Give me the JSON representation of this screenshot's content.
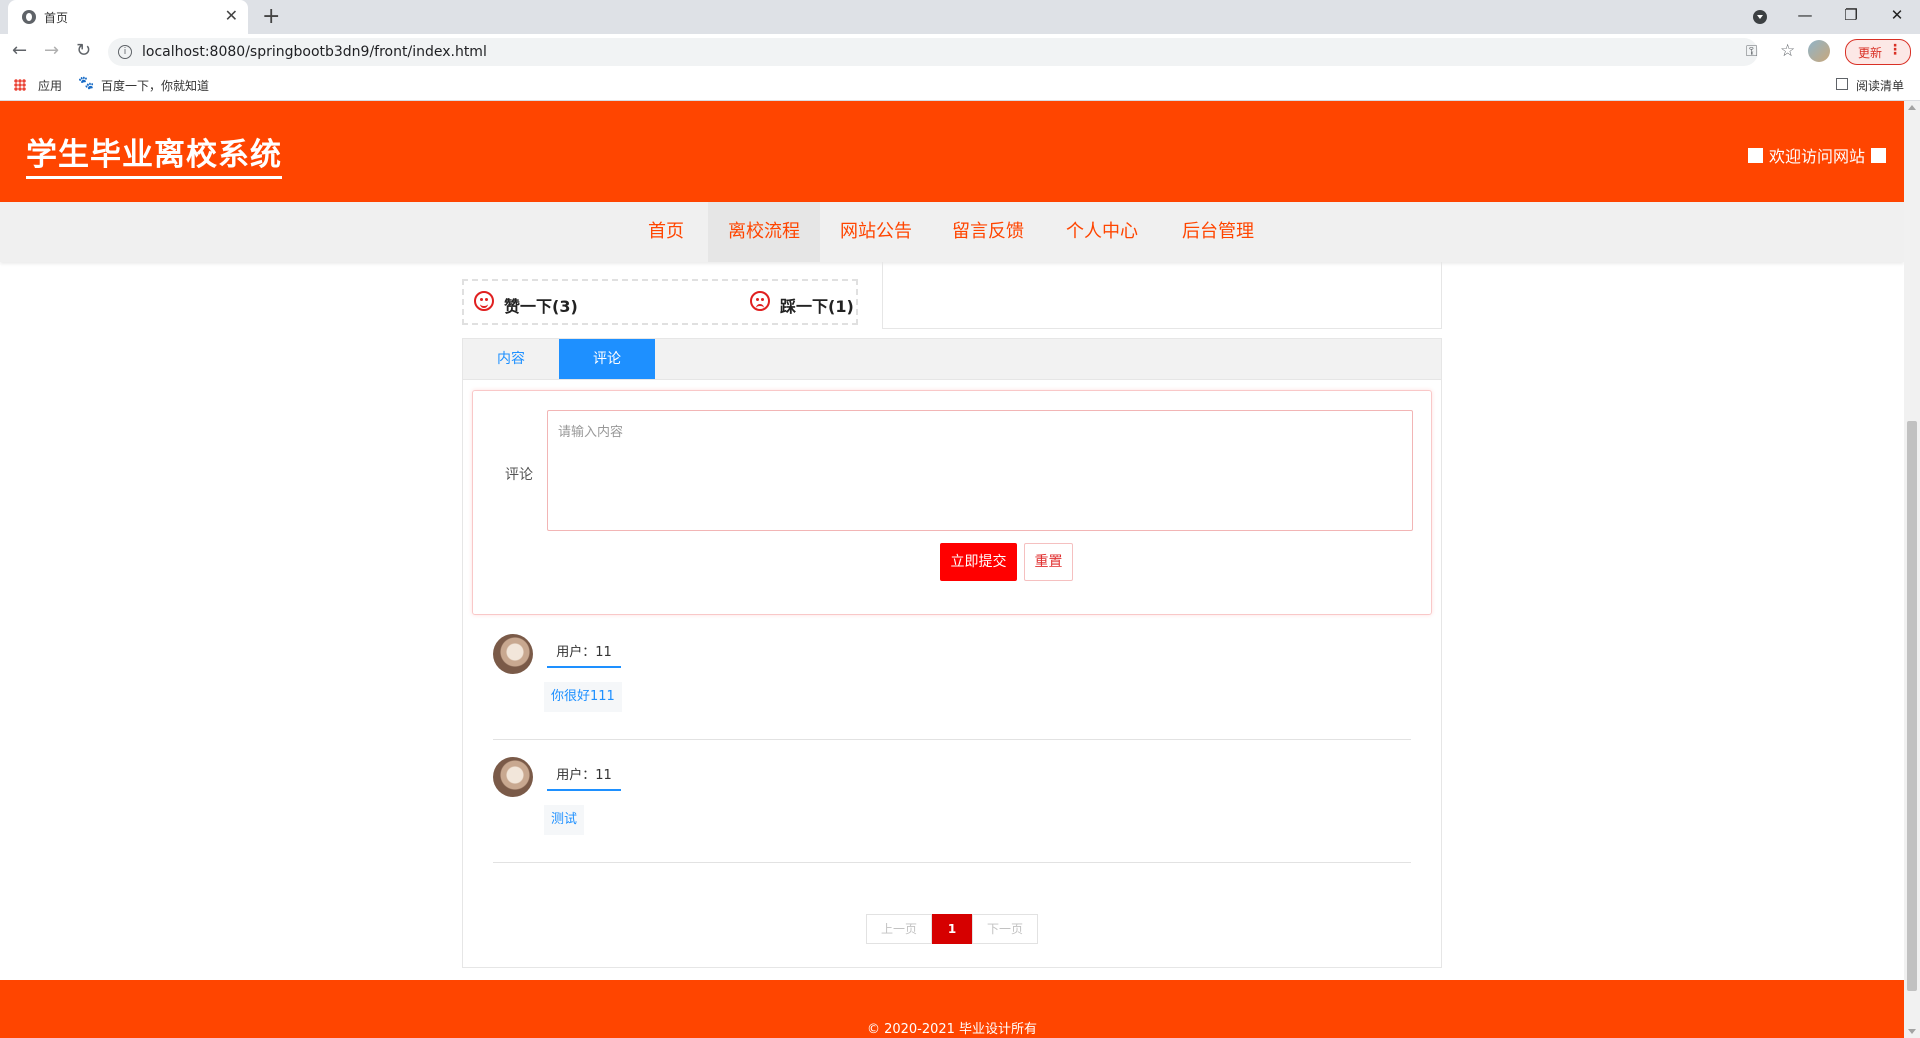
{
  "browser": {
    "tab_title": "首页",
    "url": "localhost:8080/springbootb3dn9/front/index.html",
    "update_label": "更新",
    "bookmarks": [
      "应用",
      "百度一下，你就知道"
    ],
    "reading_list": "阅读清单"
  },
  "site": {
    "title": "学生毕业离校系统",
    "welcome": "欢迎访问网站"
  },
  "nav": {
    "items": [
      "首页",
      "离校流程",
      "网站公告",
      "留言反馈",
      "个人中心",
      "后台管理"
    ],
    "active_index": 1
  },
  "votes": {
    "like_label": "赞一下(3)",
    "dislike_label": "踩一下(1)"
  },
  "tabs": {
    "content": "内容",
    "comment": "评论",
    "active": "评论"
  },
  "form": {
    "label": "评论",
    "placeholder": "请输入内容",
    "submit": "立即提交",
    "reset": "重置"
  },
  "comments": [
    {
      "user": "用户：11",
      "text": "你很好111"
    },
    {
      "user": "用户：11",
      "text": "测试"
    }
  ],
  "pager": {
    "prev": "上一页",
    "current": "1",
    "next": "下一页"
  },
  "footer": {
    "copyright": "© 2020-2021 毕业设计所有"
  },
  "colors": {
    "brand": "#ff4500",
    "accent": "#1e90ff",
    "submit": "#ff0000",
    "page_active": "#d60000"
  }
}
